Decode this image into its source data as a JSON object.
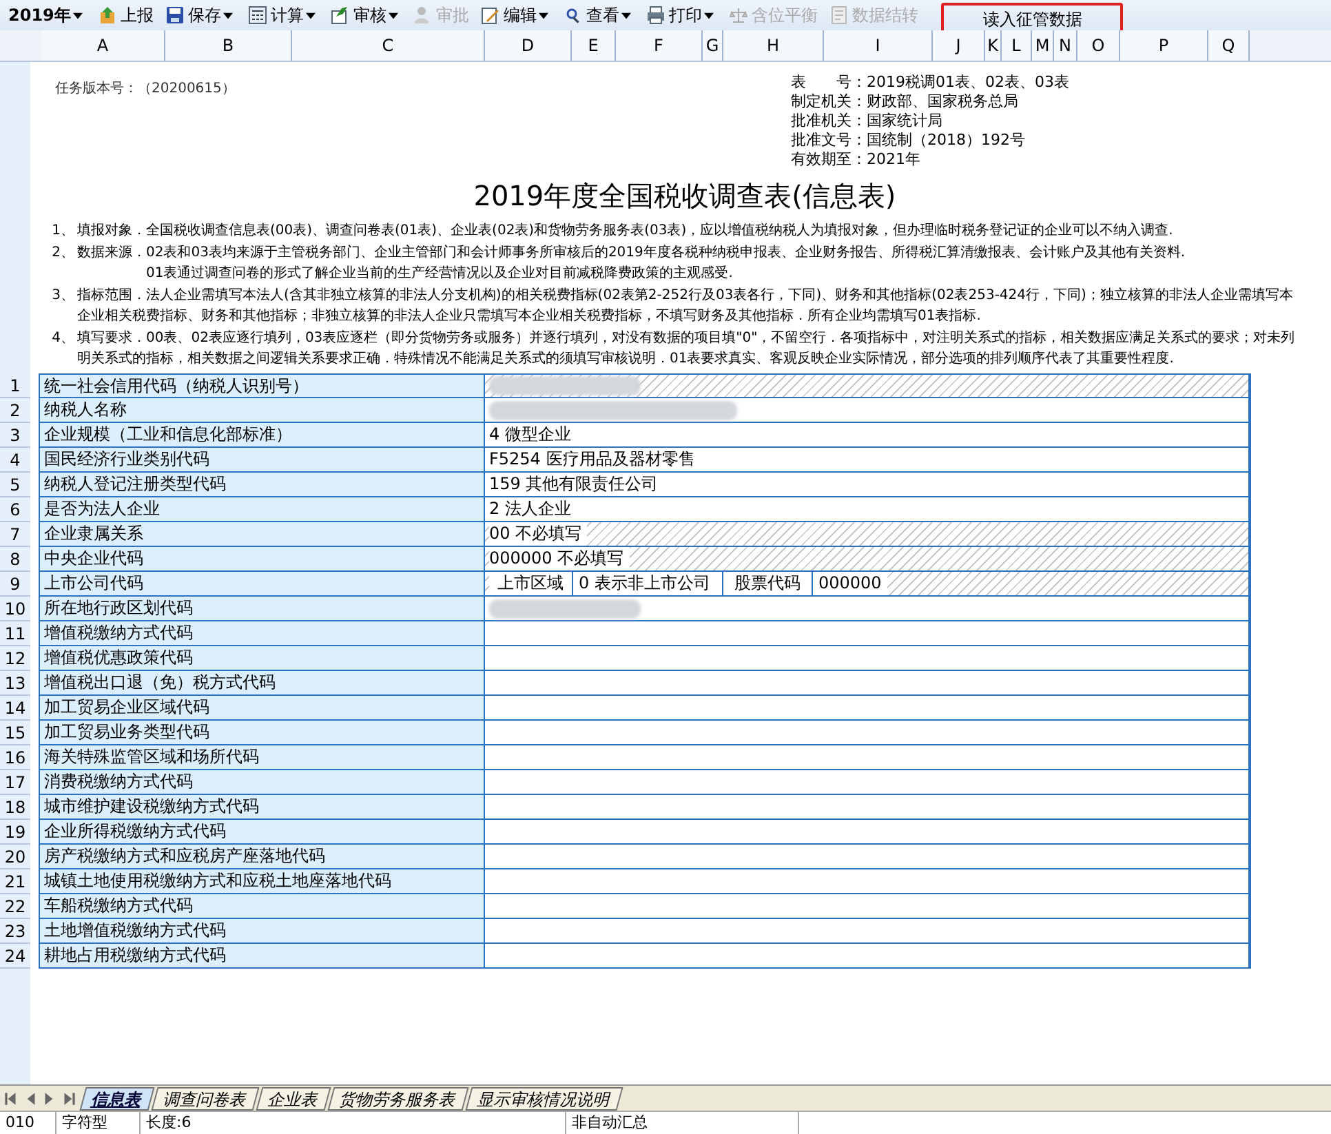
{
  "toolbar": [
    {
      "label": "2019年",
      "dropdown": true,
      "disabled": false,
      "highlighted": false
    },
    {
      "label": "上报",
      "dropdown": false,
      "disabled": false,
      "highlighted": false
    },
    {
      "label": "保存",
      "dropdown": true,
      "disabled": false,
      "highlighted": false
    },
    {
      "label": "计算",
      "dropdown": true,
      "disabled": false,
      "highlighted": false
    },
    {
      "label": "审核",
      "dropdown": true,
      "disabled": false,
      "highlighted": false
    },
    {
      "label": "审批",
      "dropdown": false,
      "disabled": true,
      "highlighted": false
    },
    {
      "label": "编辑",
      "dropdown": true,
      "disabled": false,
      "highlighted": false
    },
    {
      "label": "查看",
      "dropdown": true,
      "disabled": false,
      "highlighted": false
    },
    {
      "label": "打印",
      "dropdown": true,
      "disabled": false,
      "highlighted": false
    },
    {
      "label": "含位平衡",
      "dropdown": false,
      "disabled": true,
      "highlighted": false
    },
    {
      "label": "数据结转",
      "dropdown": false,
      "disabled": true,
      "highlighted": false
    },
    {
      "label": "读入征管数据",
      "dropdown": false,
      "disabled": false,
      "highlighted": true
    }
  ],
  "columns": [
    "A",
    "B",
    "C",
    "D",
    "E",
    "F",
    "G",
    "H",
    "I",
    "J",
    "K",
    "L",
    "M",
    "N",
    "O",
    "P",
    "Q"
  ],
  "version": "任务版本号：（20200615）",
  "meta": [
    {
      "label": "表　　号：",
      "value": "2019税调01表、02表、03表"
    },
    {
      "label": "制定机关：",
      "value": "财政部、国家税务总局"
    },
    {
      "label": "批准机关：",
      "value": "国家统计局"
    },
    {
      "label": "批准文号：",
      "value": "国统制（2018）192号"
    },
    {
      "label": "有效期至：",
      "value": "2021年"
    }
  ],
  "title": "2019年度全国税收调查表(信息表)",
  "notes": [
    {
      "number": "1、",
      "lines": [
        "填报对象．全国税收调查信息表(00表)、调查问卷表(01表)、企业表(02表)和货物劳务服务表(03表)，应以增值税纳税人为填报对象，但办理临时税务登记证的企业可以不纳入调查."
      ]
    },
    {
      "number": "2、",
      "lines": [
        "数据来源．02表和03表均来源于主管税务部门、企业主管部门和会计师事务所审核后的2019年度各税种纳税申报表、企业财务报告、所得税汇算清缴报表、会计账户及其他有关资料.",
        "01表通过调查问卷的形式了解企业当前的生产经营情况以及企业对目前减税降费政策的主观感受."
      ]
    },
    {
      "number": "3、",
      "lines": [
        "指标范围．法人企业需填写本法人(含其非独立核算的非法人分支机构)的相关税费指标(02表第2-252行及03表各行，下同)、财务和其他指标(02表253-424行，下同)；独立核算的非法人企业需填写本企业相关税费指标、财务和其他指标；非独立核算的非法人企业只需填写本企业相关税费指标，不填写财务及其他指标．所有企业均需填写01表指标."
      ]
    },
    {
      "number": "4、",
      "lines": [
        "填写要求．00表、02表应逐行填列，03表应逐栏（即分货物劳务或服务）并逐行填列，对没有数据的项目填\"0\"，不留空行．各项指标中，对注明关系式的指标，相关数据应满足关系式的要求；对未列明关系式的指标，相关数据之间逻辑关系要求正确．特殊情况不能满足关系式的须填写审核说明．01表要求真实、客观反映企业实际情况，部分选项的排列顺序代表了其重要性程度."
      ]
    }
  ],
  "rows": [
    {
      "number": "1",
      "label": "统一社会信用代码（纳税人识别号）",
      "kind": "redacted",
      "hatched": true
    },
    {
      "number": "2",
      "label": "纳税人名称",
      "kind": "redacted",
      "hatched": false
    },
    {
      "number": "3",
      "label": "企业规模（工业和信息化部标准）",
      "kind": "text",
      "value": "4 微型企业",
      "hatched": false
    },
    {
      "number": "4",
      "label": "国民经济行业类别代码",
      "kind": "text",
      "value": "F5254 医疗用品及器材零售",
      "hatched": false
    },
    {
      "number": "5",
      "label": "纳税人登记注册类型代码",
      "kind": "text",
      "value": "159 其他有限责任公司",
      "hatched": false
    },
    {
      "number": "6",
      "label": "是否为法人企业",
      "kind": "text",
      "value": "2 法人企业",
      "hatched": false
    },
    {
      "number": "7",
      "label": "企业隶属关系",
      "kind": "text",
      "value": "00 不必填写",
      "hatched": true
    },
    {
      "number": "8",
      "label": "中央企业代码",
      "kind": "text",
      "value": "000000 不必填写",
      "hatched": true
    },
    {
      "number": "9",
      "label": "上市公司代码",
      "kind": "listed",
      "parts": [
        "上市区域",
        "0 表示非上市公司",
        "股票代码",
        "000000"
      ],
      "hatched": true
    },
    {
      "number": "10",
      "label": "所在地行政区划代码",
      "kind": "redacted",
      "hatched": false
    },
    {
      "number": "11",
      "label": "增值税缴纳方式代码",
      "kind": "empty",
      "hatched": false
    },
    {
      "number": "12",
      "label": "增值税优惠政策代码",
      "kind": "empty",
      "hatched": false
    },
    {
      "number": "13",
      "label": "增值税出口退（免）税方式代码",
      "kind": "empty",
      "hatched": false
    },
    {
      "number": "14",
      "label": "加工贸易企业区域代码",
      "kind": "empty",
      "hatched": false
    },
    {
      "number": "15",
      "label": "加工贸易业务类型代码",
      "kind": "empty",
      "hatched": false
    },
    {
      "number": "16",
      "label": "海关特殊监管区域和场所代码",
      "kind": "empty",
      "hatched": false
    },
    {
      "number": "17",
      "label": "消费税缴纳方式代码",
      "kind": "empty",
      "hatched": false
    },
    {
      "number": "18",
      "label": "城市维护建设税缴纳方式代码",
      "kind": "empty",
      "hatched": false
    },
    {
      "number": "19",
      "label": "企业所得税缴纳方式代码",
      "kind": "empty",
      "hatched": false
    },
    {
      "number": "20",
      "label": "房产税缴纳方式和应税房产座落地代码",
      "kind": "empty",
      "hatched": false
    },
    {
      "number": "21",
      "label": "城镇土地使用税缴纳方式和应税土地座落地代码",
      "kind": "empty",
      "hatched": false
    },
    {
      "number": "22",
      "label": "车船税缴纳方式代码",
      "kind": "empty",
      "hatched": false
    },
    {
      "number": "23",
      "label": "土地增值税缴纳方式代码",
      "kind": "empty",
      "hatched": false
    },
    {
      "number": "24",
      "label": "耕地占用税缴纳方式代码",
      "kind": "empty",
      "hatched": false
    }
  ],
  "sheet_tabs": [
    {
      "label": "信息表",
      "selected": true
    },
    {
      "label": "调查问卷表",
      "selected": false
    },
    {
      "label": "企业表",
      "selected": false
    },
    {
      "label": "货物劳务服务表",
      "selected": false
    },
    {
      "label": "显示审核情况说明",
      "selected": false
    }
  ],
  "status_bar": [
    "010",
    "字符型",
    "长度:6",
    "非自动汇总"
  ]
}
